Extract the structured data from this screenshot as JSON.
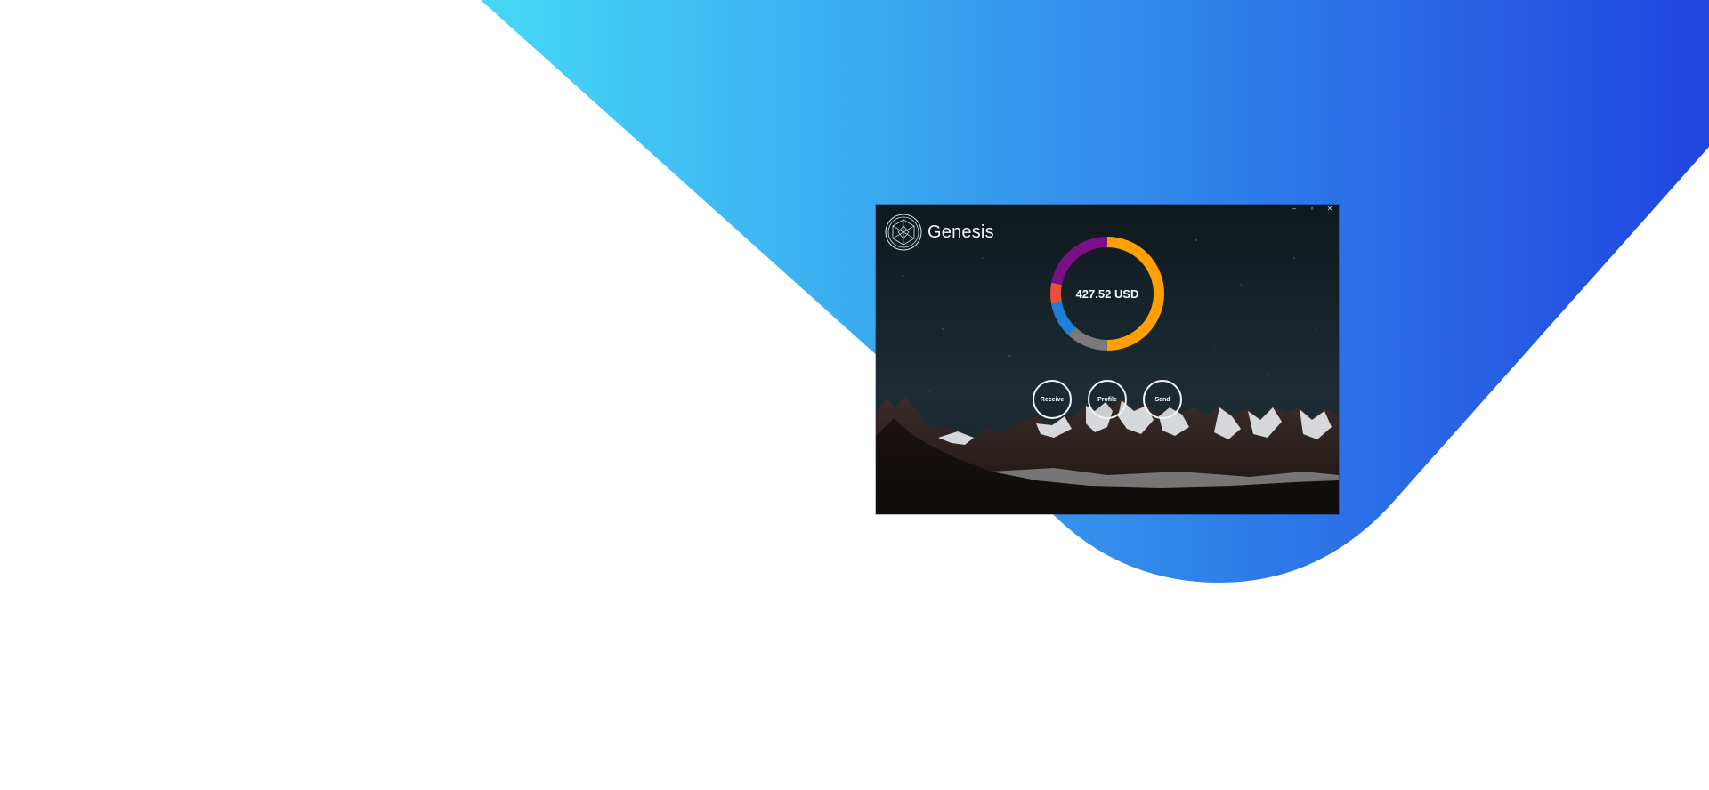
{
  "app": {
    "name": "Genesis"
  },
  "window_controls": {
    "minimize_glyph": "–",
    "maximize_glyph": "▫",
    "close_glyph": "✕"
  },
  "portfolio": {
    "balance_label": "427.52 USD",
    "segments": [
      {
        "color": "#ff9f00",
        "fraction": 0.5
      },
      {
        "color": "#7a7a7a",
        "fraction": 0.12
      },
      {
        "color": "#1e7fd9",
        "fraction": 0.1
      },
      {
        "color": "#e8503a",
        "fraction": 0.06
      },
      {
        "color": "#7b0f86",
        "fraction": 0.22
      }
    ]
  },
  "actions": {
    "receive": "Receive",
    "profile": "Profile",
    "send": "Send"
  },
  "colors": {
    "bg_gradient_start": "#46d8f7",
    "bg_gradient_end": "#2045e0",
    "button_ring": "#f2f4f5",
    "text": "#ffffff"
  },
  "icons": {
    "logo": "hexagon-crystal-logo-icon",
    "minimize": "minimize-icon",
    "maximize": "maximize-icon",
    "close": "close-icon"
  }
}
